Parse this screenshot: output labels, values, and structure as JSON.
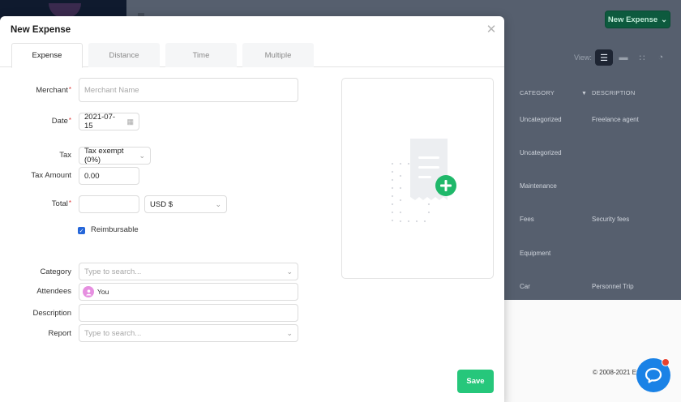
{
  "background": {
    "new_expense_button": "New Expense",
    "view_label": "View:",
    "columns": {
      "category": "CATEGORY",
      "description": "DESCRIPTION"
    },
    "rows": [
      {
        "category": "Uncategorized",
        "description": "Freelance agent"
      },
      {
        "category": "Uncategorized",
        "description": ""
      },
      {
        "category": "Maintenance",
        "description": ""
      },
      {
        "category": "Fees",
        "description": "Security fees"
      },
      {
        "category": "Equipment",
        "description": ""
      },
      {
        "category": "Car",
        "description": "Personnel Trip"
      }
    ],
    "footer": "© 2008-2021 Ex"
  },
  "modal": {
    "title": "New Expense",
    "tabs": [
      {
        "label": "Expense",
        "active": true
      },
      {
        "label": "Distance",
        "active": false
      },
      {
        "label": "Time",
        "active": false
      },
      {
        "label": "Multiple",
        "active": false
      }
    ],
    "form": {
      "merchant": {
        "label": "Merchant",
        "required": "*",
        "placeholder": "Merchant Name",
        "value": ""
      },
      "date": {
        "label": "Date",
        "required": "*",
        "value": "2021-07-15"
      },
      "tax": {
        "label": "Tax",
        "value": "Tax exempt (0%)"
      },
      "tax_amount": {
        "label": "Tax Amount",
        "value": "0.00"
      },
      "total": {
        "label": "Total",
        "required": "*",
        "value": "",
        "currency": "USD $"
      },
      "reimbursable": {
        "label": "Reimbursable",
        "checked": true
      },
      "category": {
        "label": "Category",
        "placeholder": "Type to search..."
      },
      "attendees": {
        "label": "Attendees",
        "chips": [
          {
            "name": "You"
          }
        ]
      },
      "description": {
        "label": "Description",
        "value": ""
      },
      "report": {
        "label": "Report",
        "placeholder": "Type to search..."
      }
    },
    "save_label": "Save"
  },
  "colors": {
    "accent_green": "#26c77b",
    "add_receipt_green": "#1fb86a",
    "checkbox_blue": "#2566d9",
    "chat_blue": "#1a82e6",
    "badge_red": "#e8422f"
  }
}
